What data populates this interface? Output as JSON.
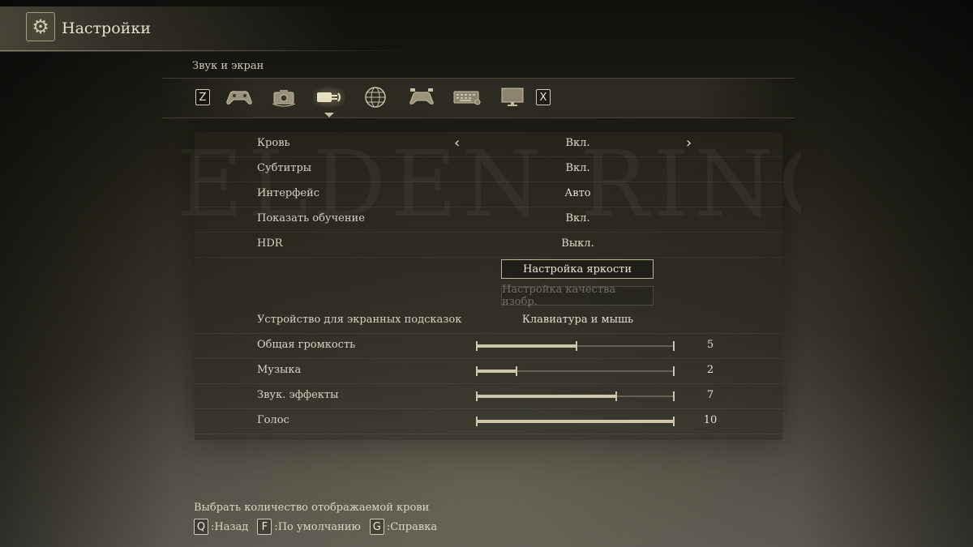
{
  "header": {
    "title": "Настройки",
    "icon": "gear-icon"
  },
  "section_title": "Звук и экран",
  "tabs": {
    "prev_key": "Z",
    "next_key": "X",
    "items": [
      {
        "icon": "gamepad-icon"
      },
      {
        "icon": "camera-icon"
      },
      {
        "icon": "sound-display-icon",
        "active": true
      },
      {
        "icon": "globe-icon"
      },
      {
        "icon": "controller-keys-icon"
      },
      {
        "icon": "keyboard-icon"
      },
      {
        "icon": "monitor-icon"
      }
    ]
  },
  "watermark": "ELDEN RING",
  "settings": {
    "blood": {
      "label": "Кровь",
      "value": "Вкл."
    },
    "subtitles": {
      "label": "Субтитры",
      "value": "Вкл."
    },
    "interface": {
      "label": "Интерфейс",
      "value": "Авто"
    },
    "tutorial": {
      "label": "Показать обучение",
      "value": "Вкл."
    },
    "hdr": {
      "label": "HDR",
      "value": "Выкл."
    },
    "brightness_button": "Настройка яркости",
    "quality_button": "Настройка качества изобр.",
    "hint_device": {
      "label": "Устройство для экранных подсказок",
      "value": "Клавиатура и мышь"
    },
    "master_volume": {
      "label": "Общая громкость",
      "value": "5",
      "level": 0.5
    },
    "music": {
      "label": "Музыка",
      "value": "2",
      "level": 0.2
    },
    "sfx": {
      "label": "Звук. эффекты",
      "value": "7",
      "level": 0.7
    },
    "voice": {
      "label": "Голос",
      "value": "10",
      "level": 1.0
    }
  },
  "footer": {
    "description": "Выбрать количество отображаемой крови",
    "hints": [
      {
        "key": "Q",
        "label": ":Назад"
      },
      {
        "key": "F",
        "label": ":По умолчанию"
      },
      {
        "key": "G",
        "label": ":Справка"
      }
    ]
  },
  "colors": {
    "accent": "#cfc7ad",
    "text": "#e2dcc9",
    "panel": "#2a2820"
  }
}
